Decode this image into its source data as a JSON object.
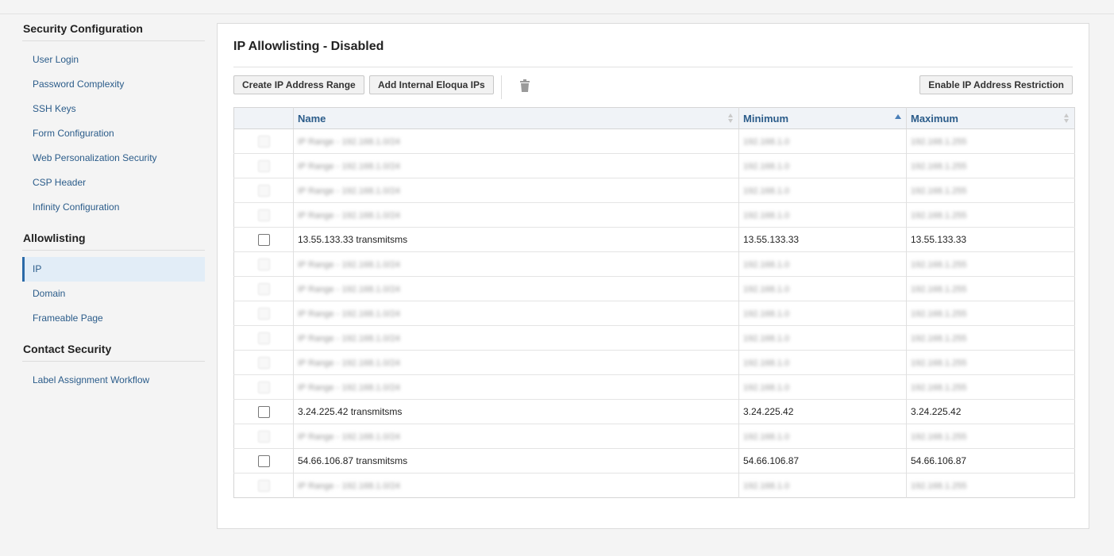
{
  "sidebar": {
    "sections": [
      {
        "title": "Security Configuration",
        "items": [
          "User Login",
          "Password Complexity",
          "SSH Keys",
          "Form Configuration",
          "Web Personalization Security",
          "CSP Header",
          "Infinity Configuration"
        ]
      },
      {
        "title": "Allowlisting",
        "items": [
          "IP",
          "Domain",
          "Frameable Page"
        ]
      },
      {
        "title": "Contact Security",
        "items": [
          "Label Assignment Workflow"
        ]
      }
    ],
    "active_item": "IP"
  },
  "main": {
    "title": "IP Allowlisting - Disabled",
    "buttons": {
      "create": "Create IP Address Range",
      "add_internal": "Add Internal Eloqua IPs",
      "enable": "Enable IP Address Restriction"
    },
    "table": {
      "headers": {
        "name": "Name",
        "minimum": "Minimum",
        "maximum": "Maximum"
      },
      "rows": [
        {
          "visible": false,
          "name": "IP Range - 192.168.1.0/24",
          "min": "192.168.1.0",
          "max": "192.168.1.255"
        },
        {
          "visible": false,
          "name": "IP Range - 192.168.1.0/24",
          "min": "192.168.1.0",
          "max": "192.168.1.255"
        },
        {
          "visible": false,
          "name": "IP Range - 192.168.1.0/24",
          "min": "192.168.1.0",
          "max": "192.168.1.255"
        },
        {
          "visible": false,
          "name": "IP Range - 192.168.1.0/24",
          "min": "192.168.1.0",
          "max": "192.168.1.255"
        },
        {
          "visible": true,
          "name": "13.55.133.33 transmitsms",
          "min": "13.55.133.33",
          "max": "13.55.133.33"
        },
        {
          "visible": false,
          "name": "IP Range - 192.168.1.0/24",
          "min": "192.168.1.0",
          "max": "192.168.1.255"
        },
        {
          "visible": false,
          "name": "IP Range - 192.168.1.0/24",
          "min": "192.168.1.0",
          "max": "192.168.1.255"
        },
        {
          "visible": false,
          "name": "IP Range - 192.168.1.0/24",
          "min": "192.168.1.0",
          "max": "192.168.1.255"
        },
        {
          "visible": false,
          "name": "IP Range - 192.168.1.0/24",
          "min": "192.168.1.0",
          "max": "192.168.1.255"
        },
        {
          "visible": false,
          "name": "IP Range - 192.168.1.0/24",
          "min": "192.168.1.0",
          "max": "192.168.1.255"
        },
        {
          "visible": false,
          "name": "IP Range - 192.168.1.0/24",
          "min": "192.168.1.0",
          "max": "192.168.1.255"
        },
        {
          "visible": true,
          "name": "3.24.225.42 transmitsms",
          "min": "3.24.225.42",
          "max": "3.24.225.42"
        },
        {
          "visible": false,
          "name": "IP Range - 192.168.1.0/24",
          "min": "192.168.1.0",
          "max": "192.168.1.255"
        },
        {
          "visible": true,
          "name": "54.66.106.87 transmitsms",
          "min": "54.66.106.87",
          "max": "54.66.106.87"
        },
        {
          "visible": false,
          "name": "IP Range - 192.168.1.0/24",
          "min": "192.168.1.0",
          "max": "192.168.1.255"
        }
      ]
    }
  },
  "icons": {
    "delete": "trash-icon"
  },
  "colors": {
    "link": "#2b5c8a",
    "active_bg": "#e2edf7",
    "header_bg": "#f0f3f7"
  }
}
